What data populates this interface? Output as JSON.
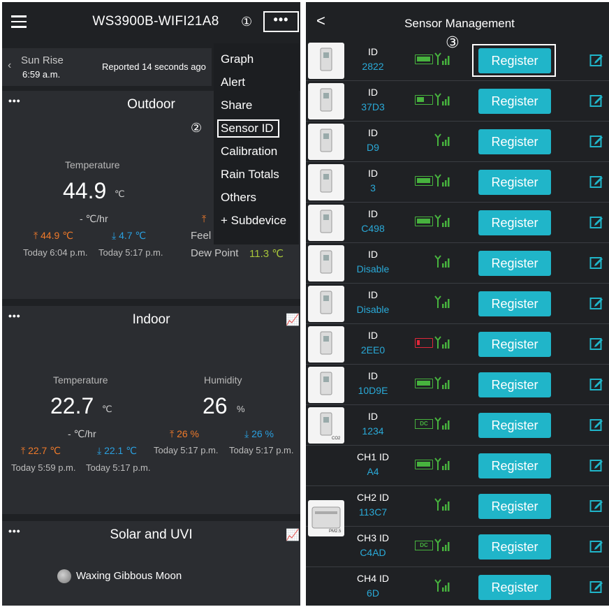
{
  "left": {
    "title": "WS3900B-WIFI21A8",
    "callout1": "①",
    "callout2": "②",
    "more": "•••",
    "sunrise": {
      "label": "Sun Rise",
      "time": "6:59 a.m."
    },
    "reported": "Reported 14 seconds ago",
    "menu": [
      "Graph",
      "Alert",
      "Share",
      "Sensor ID",
      "Calibration",
      "Rain Totals",
      "Others",
      "+ Subdevice"
    ],
    "outdoor": {
      "title": "Outdoor",
      "temp_label": "Temperature",
      "temp_value": "44.9",
      "temp_unit": "℃",
      "rate": "- ℃/hr",
      "high": "⤒ 44.9 ℃",
      "low": "⤓ 4.7 ℃",
      "high_time": "Today 6:04 p.m.",
      "low_time": "Today 5:17 p.m.",
      "feel_label": "Feel",
      "dew_label": "Dew Point",
      "dew_value": "11.3 ℃"
    },
    "indoor": {
      "title": "Indoor",
      "temp_label": "Temperature",
      "temp_value": "22.7",
      "temp_unit": "℃",
      "temp_rate": "- ℃/hr",
      "temp_high": "⤒ 22.7 ℃",
      "temp_low": "⤓ 22.1 ℃",
      "temp_high_time": "Today 5:59 p.m.",
      "temp_low_time": "Today 5:17 p.m.",
      "hum_label": "Humidity",
      "hum_value": "26",
      "hum_unit": "%",
      "hum_high": "⤒ 26 %",
      "hum_low": "⤓ 26 %",
      "hum_high_time": "Today 5:17 p.m.",
      "hum_low_time": "Today 5:17 p.m."
    },
    "solar": {
      "title": "Solar and UVI",
      "moon": "Waxing Gibbous Moon"
    },
    "colors": {
      "high": "#f07a2a",
      "low": "#2aa0e0",
      "accent": "#e8b020"
    }
  },
  "right": {
    "title": "Sensor Management",
    "callout3": "③",
    "register_label": "Register",
    "rows": [
      {
        "label": "ID",
        "value": "2822",
        "power": "battery",
        "level": 1.0
      },
      {
        "label": "ID",
        "value": "37D3",
        "power": "battery",
        "level": 0.5
      },
      {
        "label": "ID",
        "value": "D9",
        "power": "none"
      },
      {
        "label": "ID",
        "value": "3",
        "power": "battery",
        "level": 1.0
      },
      {
        "label": "ID",
        "value": "C498",
        "power": "battery",
        "level": 1.0
      },
      {
        "label": "ID",
        "value": "Disable",
        "power": "none"
      },
      {
        "label": "ID",
        "value": "Disable",
        "power": "none"
      },
      {
        "label": "ID",
        "value": "2EE0",
        "power": "battery-low",
        "level": 0.2
      },
      {
        "label": "ID",
        "value": "10D9E",
        "power": "battery",
        "level": 1.0
      },
      {
        "label": "ID",
        "value": "1234",
        "power": "dc"
      },
      {
        "label": "CH1 ID",
        "value": "A4",
        "power": "battery",
        "level": 1.0
      },
      {
        "label": "CH2 ID",
        "value": "113C7",
        "power": "none"
      },
      {
        "label": "CH3 ID",
        "value": "C4AD",
        "power": "dc"
      },
      {
        "label": "CH4 ID",
        "value": "6D",
        "power": "none"
      }
    ],
    "dc_label": "DC",
    "thumb_labels": {
      "co2": "CO2",
      "pm25": "PM2.5"
    },
    "colors": {
      "button": "#20b5c9",
      "id": "#2aaad8",
      "signal": "#47b33e"
    }
  }
}
